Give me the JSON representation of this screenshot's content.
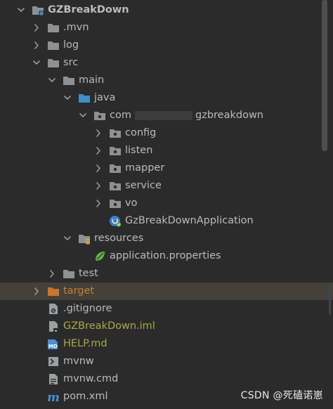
{
  "tree": {
    "rows": [
      {
        "kind": "project",
        "label": "GZBreakDown",
        "depth": 0,
        "expanded": true,
        "bold": true,
        "icon": "module-folder-icon",
        "name": "tree-item-gzbreakdown"
      },
      {
        "kind": "folder",
        "label": ".mvn",
        "depth": 1,
        "expanded": false,
        "icon": "folder-icon",
        "name": "tree-item-mvn"
      },
      {
        "kind": "folder",
        "label": "log",
        "depth": 1,
        "expanded": false,
        "icon": "folder-icon",
        "name": "tree-item-log"
      },
      {
        "kind": "folder",
        "label": "src",
        "depth": 1,
        "expanded": true,
        "icon": "folder-icon",
        "name": "tree-item-src"
      },
      {
        "kind": "folder",
        "label": "main",
        "depth": 2,
        "expanded": true,
        "icon": "folder-icon",
        "name": "tree-item-main"
      },
      {
        "kind": "folder",
        "label": "java",
        "depth": 3,
        "expanded": true,
        "icon": "source-folder-icon",
        "name": "tree-item-java"
      },
      {
        "kind": "package",
        "label": "com",
        "suffix": "gzbreakdown",
        "masked": true,
        "depth": 4,
        "expanded": true,
        "icon": "package-icon",
        "name": "tree-item-package-root"
      },
      {
        "kind": "package",
        "label": "config",
        "depth": 5,
        "expanded": false,
        "icon": "package-icon",
        "name": "tree-item-config"
      },
      {
        "kind": "package",
        "label": "listen",
        "depth": 5,
        "expanded": false,
        "icon": "package-icon",
        "name": "tree-item-listen"
      },
      {
        "kind": "package",
        "label": "mapper",
        "depth": 5,
        "expanded": false,
        "icon": "package-icon",
        "name": "tree-item-mapper"
      },
      {
        "kind": "package",
        "label": "service",
        "depth": 5,
        "expanded": false,
        "icon": "package-icon",
        "name": "tree-item-service"
      },
      {
        "kind": "package",
        "label": "vo",
        "depth": 5,
        "expanded": false,
        "icon": "package-icon",
        "name": "tree-item-vo"
      },
      {
        "kind": "file",
        "label": "GzBreakDownApplication",
        "depth": 5,
        "icon": "spring-boot-class-icon",
        "name": "tree-item-gzbreakdownapplication"
      },
      {
        "kind": "folder",
        "label": "resources",
        "depth": 3,
        "expanded": true,
        "icon": "resources-folder-icon",
        "name": "tree-item-resources"
      },
      {
        "kind": "file",
        "label": "application.properties",
        "depth": 4,
        "icon": "spring-properties-icon",
        "name": "tree-item-application-properties"
      },
      {
        "kind": "folder",
        "label": "test",
        "depth": 2,
        "expanded": false,
        "icon": "folder-icon",
        "name": "tree-item-test"
      },
      {
        "kind": "folder",
        "label": "target",
        "depth": 1,
        "expanded": false,
        "icon": "excluded-folder-icon",
        "color": "orange",
        "selected": true,
        "name": "tree-item-target"
      },
      {
        "kind": "file",
        "label": ".gitignore",
        "depth": 1,
        "icon": "gitignore-file-icon",
        "name": "tree-item-gitignore"
      },
      {
        "kind": "file",
        "label": "GZBreakDown.iml",
        "depth": 1,
        "icon": "iml-file-icon",
        "color": "olive",
        "name": "tree-item-gzbreakdown-iml"
      },
      {
        "kind": "file",
        "label": "HELP.md",
        "depth": 1,
        "icon": "markdown-file-icon",
        "color": "olive",
        "name": "tree-item-help-md"
      },
      {
        "kind": "file",
        "label": "mvnw",
        "depth": 1,
        "icon": "shell-script-icon",
        "name": "tree-item-mvnw"
      },
      {
        "kind": "file",
        "label": "mvnw.cmd",
        "depth": 1,
        "icon": "text-file-icon",
        "name": "tree-item-mvnw-cmd"
      },
      {
        "kind": "file",
        "label": "pom.xml",
        "depth": 1,
        "icon": "maven-pom-icon",
        "name": "tree-item-pom-xml"
      }
    ]
  },
  "colors": {
    "background": "#2b2b2b",
    "text": "#bbbbbb",
    "arrow": "#9a9a9a",
    "folder": "#8d9194",
    "source_folder": "#3d8fc6",
    "excluded_folder": "#c8752f",
    "modified_file_text": "#a9a84a",
    "selected_row": "#45413a",
    "spring_green": "#62b543"
  },
  "watermark": "CSDN @死磕诺崽"
}
